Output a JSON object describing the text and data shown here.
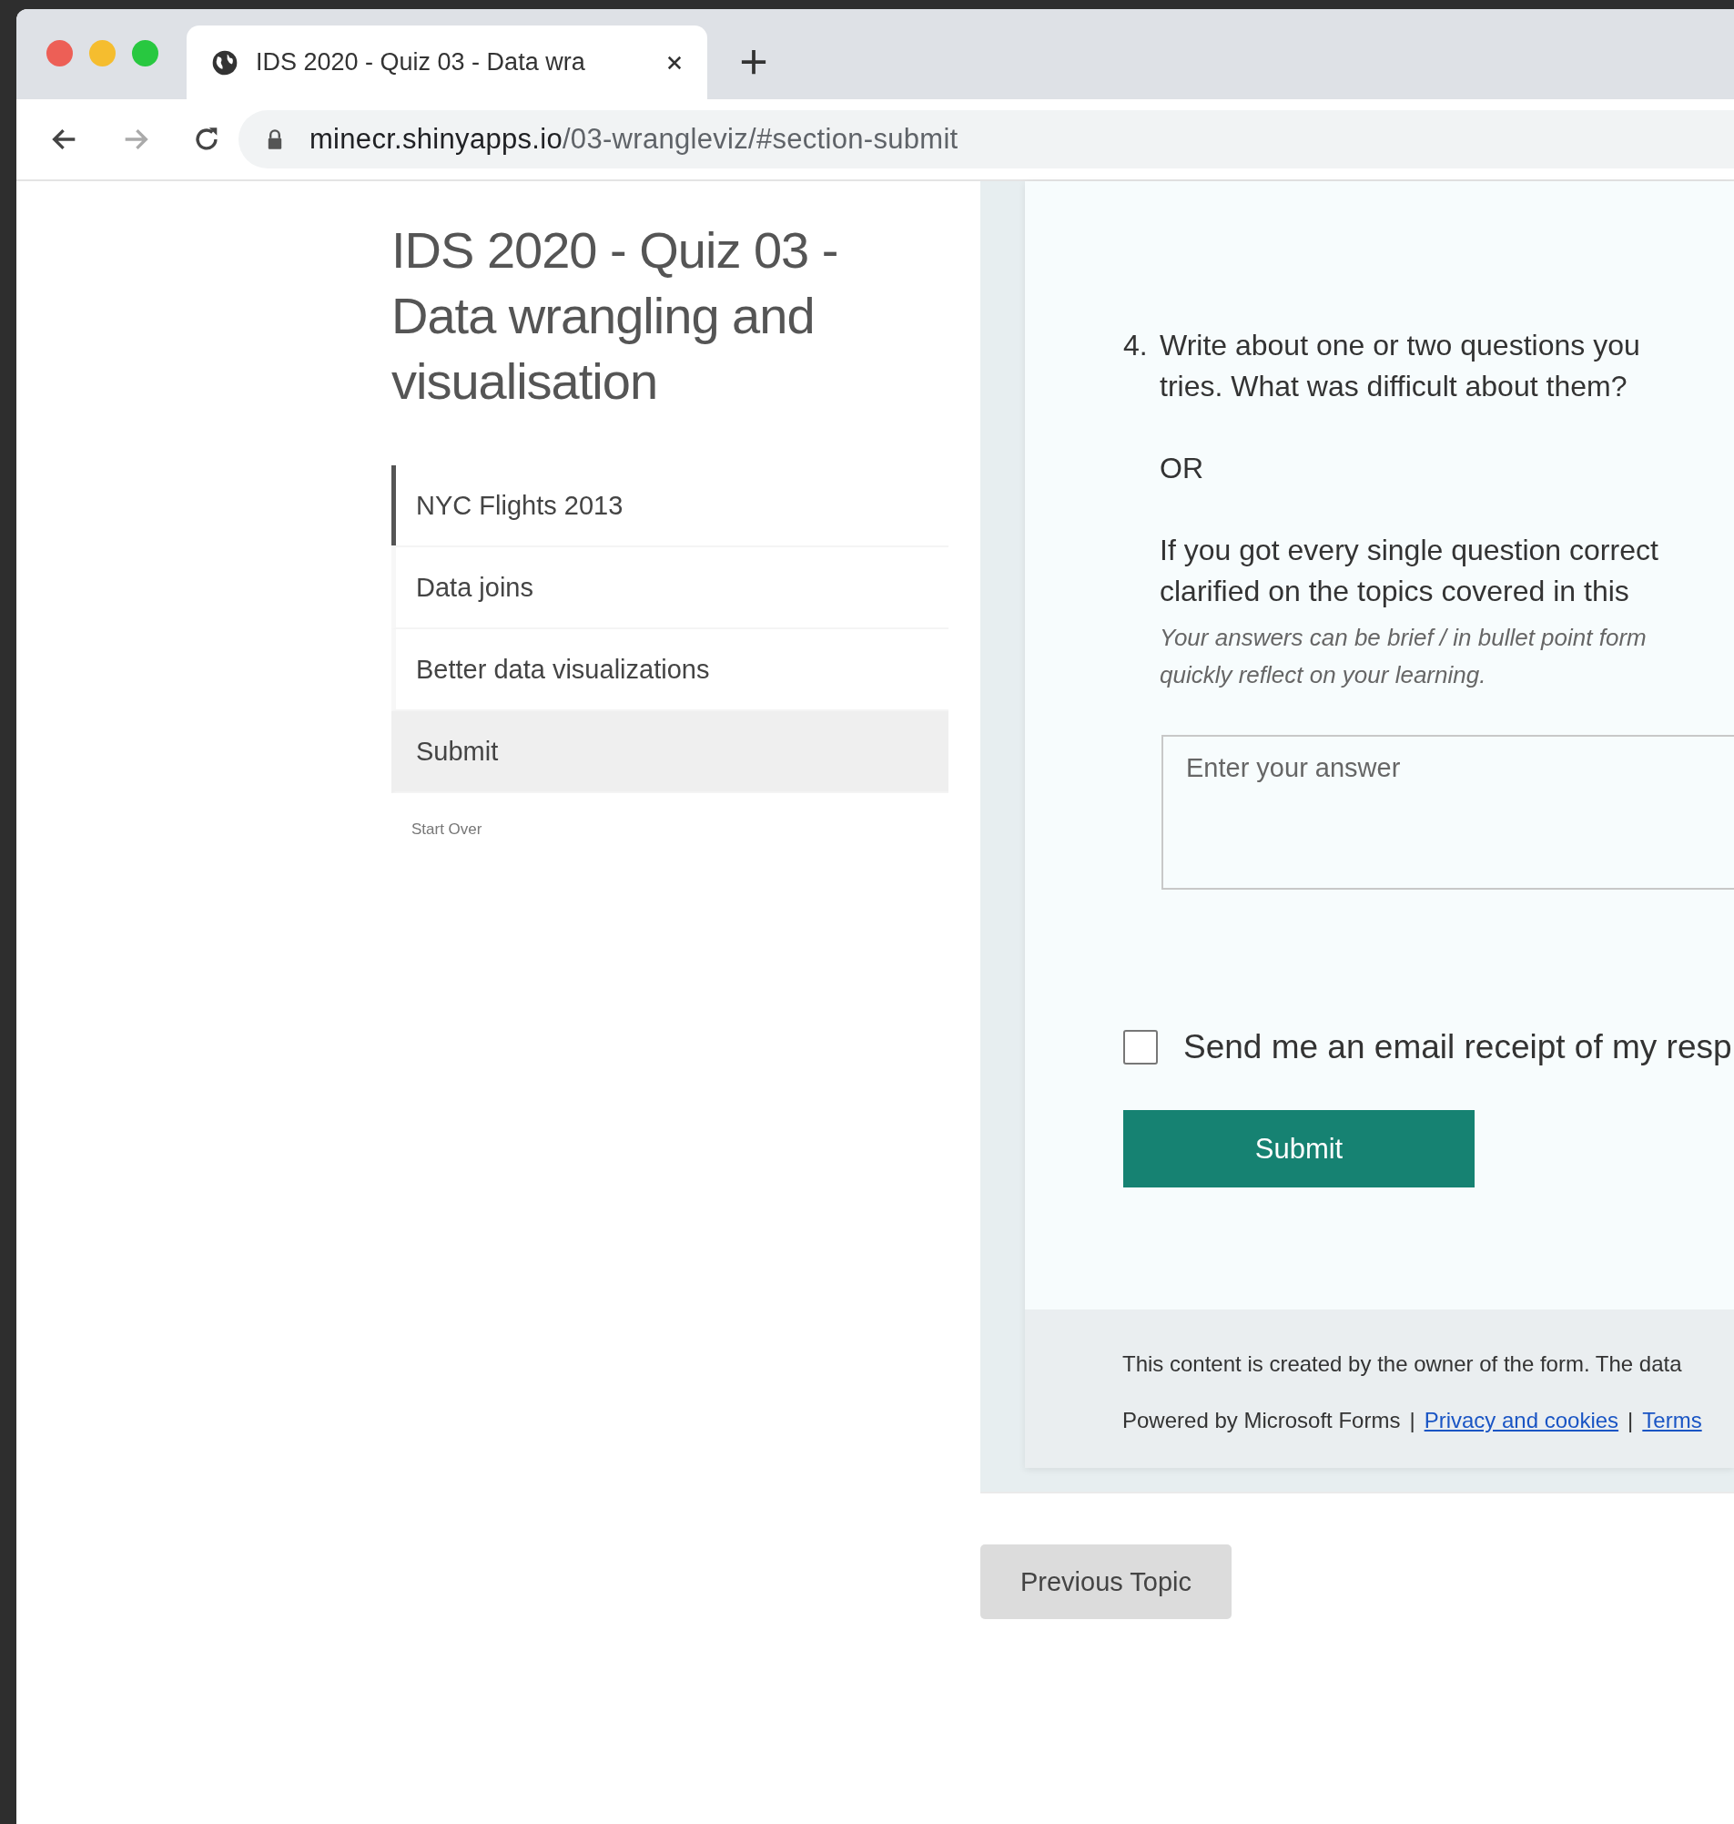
{
  "browser": {
    "tab": {
      "title": "IDS 2020 - Quiz 03 - Data wra",
      "selected": true
    },
    "address": {
      "host": "minecr.shinyapps.io",
      "path": "/03-wrangleviz/#section-submit"
    }
  },
  "sidebar": {
    "title": "IDS 2020 - Quiz 03 - Data wrangling and visualisation",
    "items": [
      {
        "label": "NYC Flights 2013",
        "selected": false,
        "marked": true
      },
      {
        "label": "Data joins",
        "selected": false,
        "marked": false
      },
      {
        "label": "Better data visualizations",
        "selected": false,
        "marked": false
      },
      {
        "label": "Submit",
        "selected": true,
        "marked": false
      }
    ],
    "start_over": "Start Over"
  },
  "form": {
    "question": {
      "number": "4.",
      "paragraphs": [
        {
          "kind": "text",
          "lines": [
            "Write about one or two questions you",
            "tries. What was difficult about them?"
          ]
        },
        {
          "kind": "text",
          "lines": [
            "OR"
          ]
        },
        {
          "kind": "text",
          "lines": [
            "If you got every single question correct",
            "clarified on the topics covered in this"
          ]
        },
        {
          "kind": "hint",
          "lines": [
            "Your answers can be brief / in bullet point form",
            "quickly reflect on your learning."
          ]
        }
      ],
      "answer": {
        "placeholder": "Enter your answer"
      }
    },
    "email_receipt": {
      "label": "Send me an email receipt of my resp",
      "checked": false
    },
    "submit": "Submit",
    "footer": {
      "notice": "This content is created by the owner of the form. The data",
      "powered": "Powered by Microsoft Forms",
      "separator": "|",
      "links": [
        "Privacy and cookies",
        "Terms"
      ]
    }
  },
  "previous_button": "Previous Topic"
}
